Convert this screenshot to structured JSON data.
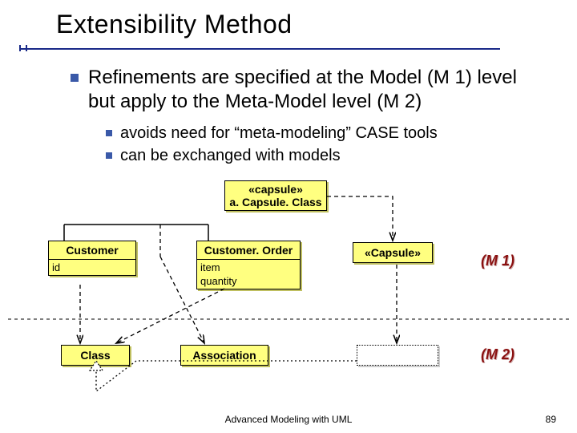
{
  "title": "Extensibility Method",
  "bullets": {
    "main": "Refinements are specified at the Model (M 1) level but apply to the Meta-Model level (M 2)",
    "sub1": "avoids need for “meta-modeling” CASE tools",
    "sub2": "can be exchanged with models"
  },
  "diagram": {
    "capsule_stereo": "«capsule»",
    "capsule_name": "a. Capsule. Class",
    "customer": "Customer",
    "customer_attr": "id",
    "order": "Customer. Order",
    "order_attr1": "item",
    "order_attr2": "quantity",
    "capsule_box": "«Capsule»",
    "class_box": "Class",
    "association_box": "Association",
    "level_m1": "(M 1)",
    "level_m2": "(M 2)"
  },
  "footer": "Advanced Modeling with UML",
  "page": "89"
}
